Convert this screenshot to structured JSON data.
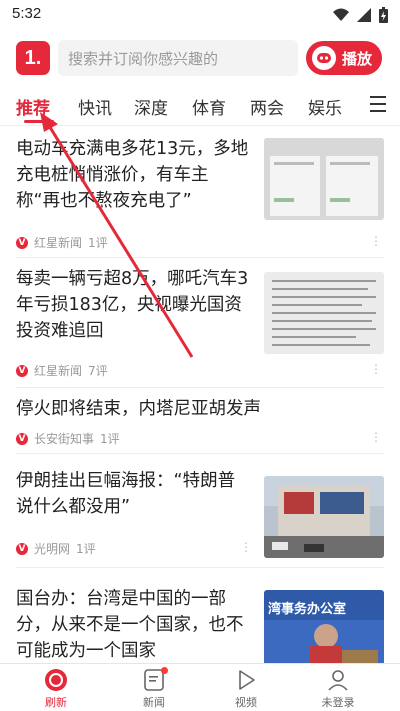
{
  "status_bar": {
    "time": "5:32"
  },
  "header": {
    "logo_text": "1.",
    "search_placeholder": "搜索并订阅你感兴趣的",
    "play_label": "播放"
  },
  "tabs": [
    {
      "label": "推荐",
      "active": true
    },
    {
      "label": "快讯"
    },
    {
      "label": "深度"
    },
    {
      "label": "体育"
    },
    {
      "label": "两会"
    },
    {
      "label": "娱乐"
    }
  ],
  "news": [
    {
      "title": "电动车充满电多花13元，多地充电桩悄悄涨价，有车主称“再也不熬夜充电了”",
      "source": "红星新闻",
      "comments": "1评",
      "has_image": true
    },
    {
      "title": "每卖一辆亏超8万，哪吒汽车3年亏损183亿，央视曝光国资投资难追回",
      "source": "红星新闻",
      "comments": "7评",
      "has_image": true
    },
    {
      "title": "停火即将结束，内塔尼亚胡发声",
      "source": "长安街知事",
      "comments": "1评",
      "has_image": false
    },
    {
      "title": "伊朗挂出巨幅海报：“特朗普说什么都没用”",
      "source": "光明网",
      "comments": "1评",
      "has_image": true
    },
    {
      "title": "国台办：台湾是中国的一部分，从来不是一个国家，也不可能成为一个国家",
      "source": "",
      "comments": "",
      "has_image": true,
      "image_caption": "湾事务办公室"
    }
  ],
  "bottom_nav": [
    {
      "label": "刷新",
      "icon": "refresh-icon",
      "active": true
    },
    {
      "label": "新闻",
      "icon": "news-icon",
      "badge": true
    },
    {
      "label": "视频",
      "icon": "video-icon"
    },
    {
      "label": "未登录",
      "icon": "user-icon"
    }
  ],
  "colors": {
    "accent": "#e5283a"
  }
}
